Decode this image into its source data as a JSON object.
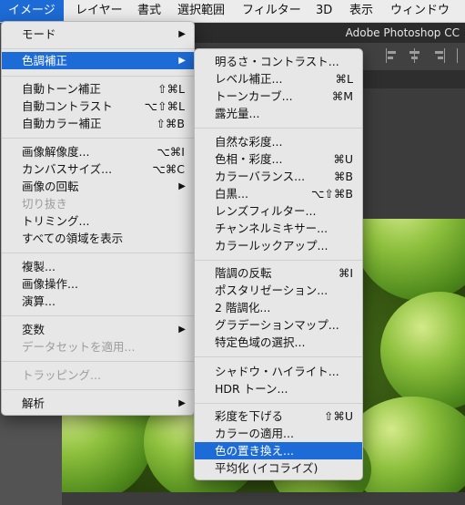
{
  "menubar": {
    "items": [
      "イメージ",
      "レイヤー",
      "書式",
      "選択範囲",
      "フィルター",
      "3D",
      "表示",
      "ウィンドウ"
    ]
  },
  "app_title": "Adobe Photoshop CC",
  "image_menu": {
    "items": [
      {
        "label": "モード",
        "shortcut": "",
        "submenu": true,
        "disabled": false
      },
      {
        "label": "色調補正",
        "shortcut": "",
        "submenu": true,
        "disabled": false,
        "highlighted": true
      },
      {
        "label": "自動トーン補正",
        "shortcut": "⇧⌘L",
        "submenu": false,
        "disabled": false
      },
      {
        "label": "自動コントラスト",
        "shortcut": "⌥⇧⌘L",
        "submenu": false,
        "disabled": false
      },
      {
        "label": "自動カラー補正",
        "shortcut": "⇧⌘B",
        "submenu": false,
        "disabled": false
      },
      {
        "label": "画像解像度...",
        "shortcut": "⌥⌘I",
        "submenu": false,
        "disabled": false
      },
      {
        "label": "カンバスサイズ...",
        "shortcut": "⌥⌘C",
        "submenu": false,
        "disabled": false
      },
      {
        "label": "画像の回転",
        "shortcut": "",
        "submenu": true,
        "disabled": false
      },
      {
        "label": "切り抜き",
        "shortcut": "",
        "submenu": false,
        "disabled": true
      },
      {
        "label": "トリミング...",
        "shortcut": "",
        "submenu": false,
        "disabled": false
      },
      {
        "label": "すべての領域を表示",
        "shortcut": "",
        "submenu": false,
        "disabled": false
      },
      {
        "label": "複製...",
        "shortcut": "",
        "submenu": false,
        "disabled": false
      },
      {
        "label": "画像操作...",
        "shortcut": "",
        "submenu": false,
        "disabled": false
      },
      {
        "label": "演算...",
        "shortcut": "",
        "submenu": false,
        "disabled": false
      },
      {
        "label": "変数",
        "shortcut": "",
        "submenu": true,
        "disabled": false
      },
      {
        "label": "データセットを適用...",
        "shortcut": "",
        "submenu": false,
        "disabled": true
      },
      {
        "label": "トラッピング...",
        "shortcut": "",
        "submenu": false,
        "disabled": true
      },
      {
        "label": "解析",
        "shortcut": "",
        "submenu": true,
        "disabled": false
      }
    ]
  },
  "adjustments_menu": {
    "items": [
      {
        "label": "明るさ・コントラスト...",
        "shortcut": ""
      },
      {
        "label": "レベル補正...",
        "shortcut": "⌘L"
      },
      {
        "label": "トーンカーブ...",
        "shortcut": "⌘M"
      },
      {
        "label": "露光量...",
        "shortcut": ""
      },
      {
        "label": "自然な彩度...",
        "shortcut": ""
      },
      {
        "label": "色相・彩度...",
        "shortcut": "⌘U"
      },
      {
        "label": "カラーバランス...",
        "shortcut": "⌘B"
      },
      {
        "label": "白黒...",
        "shortcut": "⌥⇧⌘B"
      },
      {
        "label": "レンズフィルター...",
        "shortcut": ""
      },
      {
        "label": "チャンネルミキサー...",
        "shortcut": ""
      },
      {
        "label": "カラールックアップ...",
        "shortcut": ""
      },
      {
        "label": "階調の反転",
        "shortcut": "⌘I"
      },
      {
        "label": "ポスタリゼーション...",
        "shortcut": ""
      },
      {
        "label": "2 階調化...",
        "shortcut": ""
      },
      {
        "label": "グラデーションマップ...",
        "shortcut": ""
      },
      {
        "label": "特定色域の選択...",
        "shortcut": ""
      },
      {
        "label": "シャドウ・ハイライト...",
        "shortcut": ""
      },
      {
        "label": "HDR トーン...",
        "shortcut": ""
      },
      {
        "label": "彩度を下げる",
        "shortcut": "⇧⌘U"
      },
      {
        "label": "カラーの適用...",
        "shortcut": ""
      },
      {
        "label": "色の置き換え...",
        "shortcut": "",
        "highlighted": true
      },
      {
        "label": "平均化 (イコライズ)",
        "shortcut": ""
      }
    ]
  },
  "icons": {
    "submenu_arrow": "▶"
  },
  "colors": {
    "highlight": "#1d6bd6",
    "menu_bg": "#e7e7e7",
    "disabled_text": "#9c9c9c"
  }
}
